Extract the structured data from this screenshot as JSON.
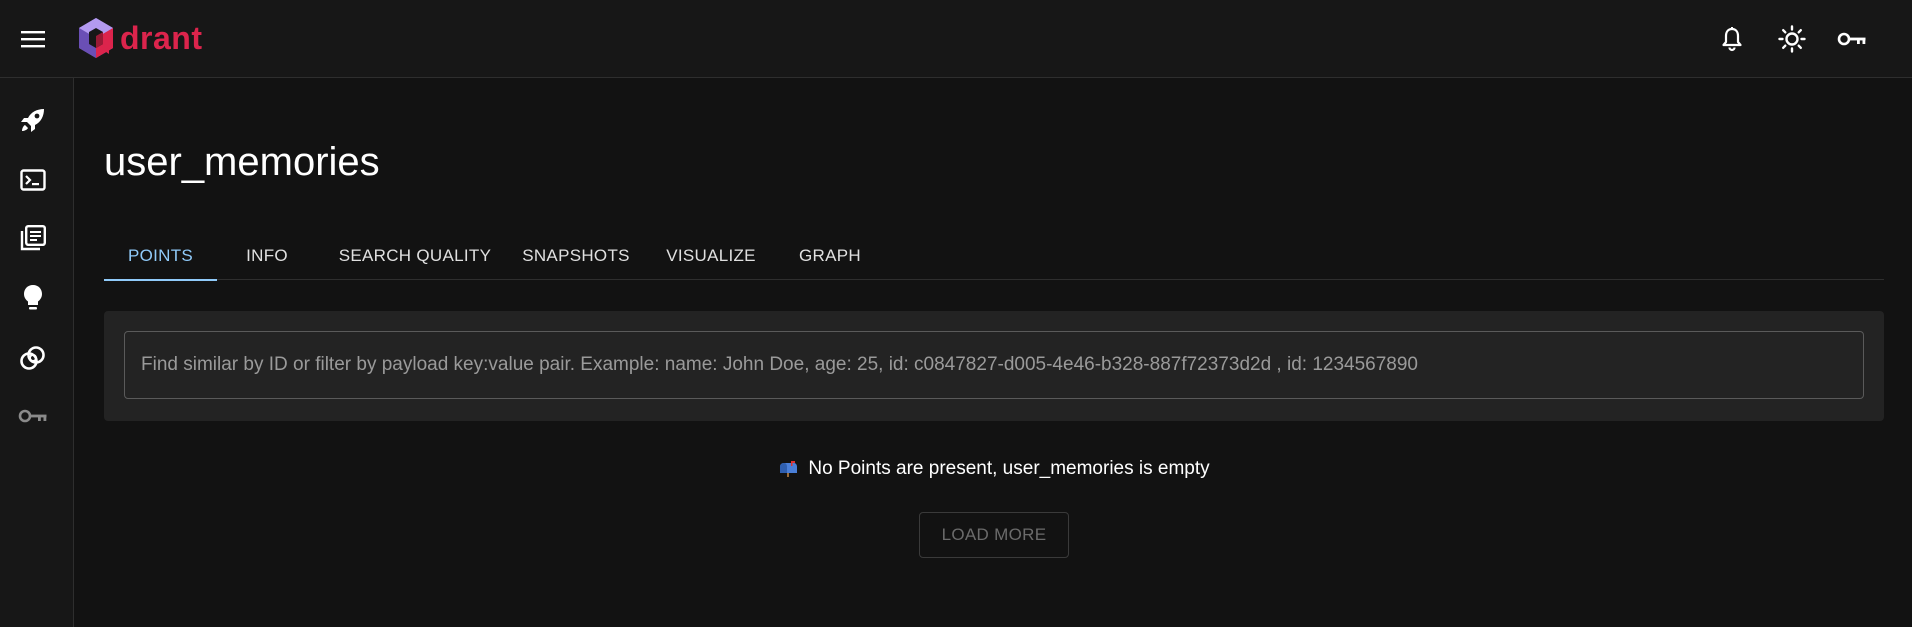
{
  "app": {
    "logo_text": "drant",
    "brand_color": "#dc244c"
  },
  "header": {
    "icons": [
      "menu-icon",
      "bell-icon",
      "sun-icon",
      "key-icon"
    ]
  },
  "sidebar": {
    "items": [
      {
        "icon": "rocket-icon"
      },
      {
        "icon": "terminal-icon"
      },
      {
        "icon": "collections-icon"
      },
      {
        "icon": "lightbulb-icon"
      },
      {
        "icon": "tools-icon"
      },
      {
        "icon": "key-icon"
      }
    ]
  },
  "page": {
    "title": "user_memories"
  },
  "tabs": [
    {
      "label": "POINTS",
      "active": true
    },
    {
      "label": "INFO",
      "active": false
    },
    {
      "label": "SEARCH QUALITY",
      "active": false
    },
    {
      "label": "SNAPSHOTS",
      "active": false
    },
    {
      "label": "VISUALIZE",
      "active": false
    },
    {
      "label": "GRAPH",
      "active": false
    }
  ],
  "search": {
    "value": "",
    "placeholder": "Find similar by ID or filter by payload key:value pair. Example: name: John Doe, age: 25, id: c0847827-d005-4e46-b328-887f72373d2d , id: 1234567890"
  },
  "empty_state": {
    "icon": "mailbox-icon",
    "message": "No Points are present, user_memories is empty"
  },
  "actions": {
    "load_more_label": "LOAD MORE",
    "load_more_disabled": true
  },
  "colors": {
    "accent": "#90caf9",
    "background": "#121212",
    "panel": "#232323"
  }
}
